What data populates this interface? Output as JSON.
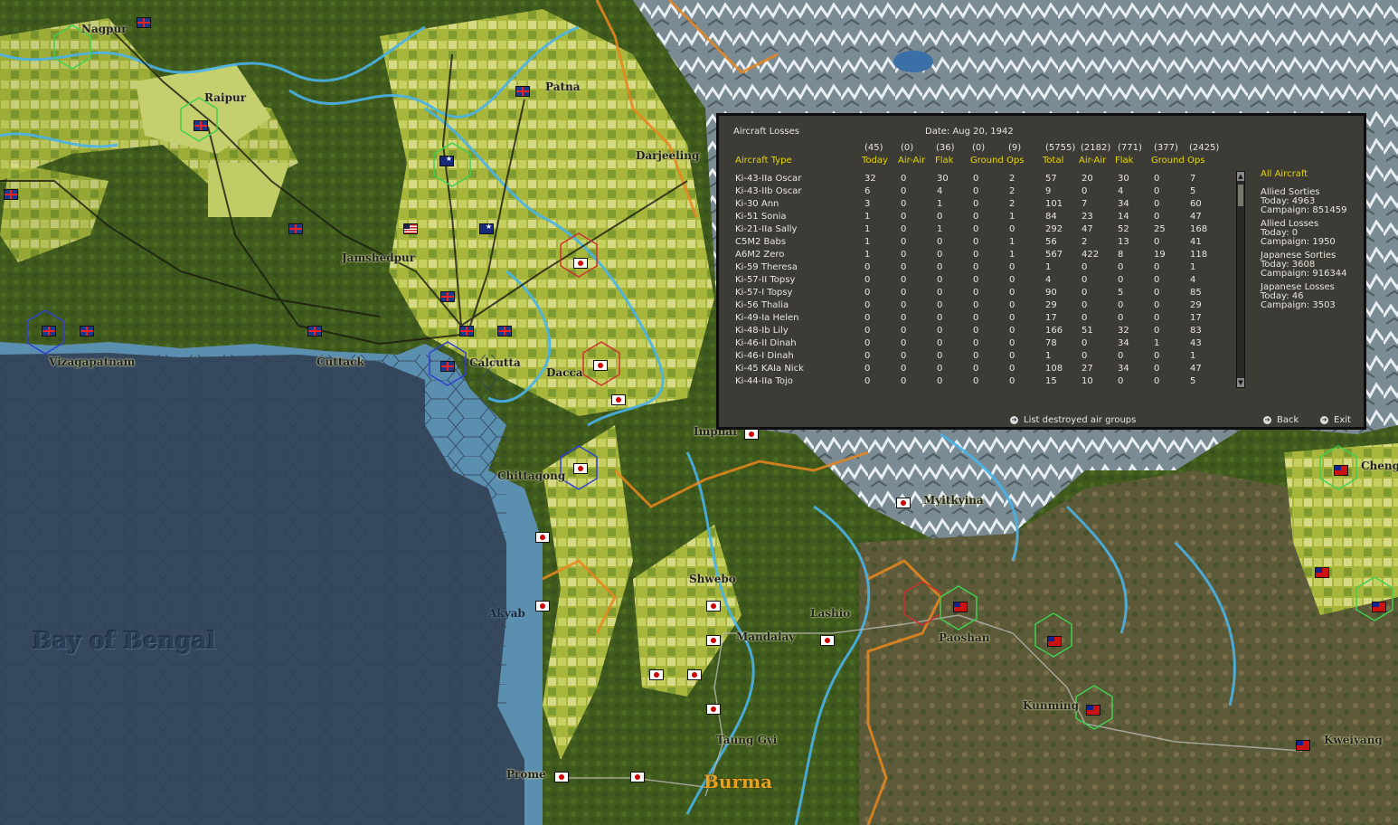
{
  "map": {
    "sea_label": "Bay of Bengal",
    "region_label": "Burma",
    "cities": [
      "Nagpur",
      "Raipur",
      "Patna",
      "Darjeeling",
      "Jamshedpur",
      "Vizagapatnam",
      "Cuttack",
      "Calcutta",
      "Dacca",
      "Imphal",
      "Chittagong",
      "Myitkyina",
      "Shwebo",
      "Akyab",
      "Lashio",
      "Mandalay",
      "Paoshan",
      "Kunming",
      "Taung Gyi",
      "Prome",
      "Kweiyang",
      "Cheng"
    ]
  },
  "losses": {
    "title": "Aircraft Losses",
    "date": "Date: Aug 20, 1942",
    "type_header": "Aircraft Type",
    "allied_totals": [
      "(45)",
      "(0)",
      "(36)",
      "(0)",
      "(9)"
    ],
    "campaign_totals": [
      "(5755)",
      "(2182)",
      "(771)",
      "(377)",
      "(2425)"
    ],
    "headers_today": [
      "Today",
      "Air-Air",
      "Flak",
      "Ground",
      "Ops"
    ],
    "headers_total": [
      "Total",
      "Air-Air",
      "Flak",
      "Ground",
      "Ops"
    ],
    "rows": [
      [
        "Ki-43-IIa Oscar",
        "32",
        "0",
        "30",
        "0",
        "2",
        "57",
        "20",
        "30",
        "0",
        "7"
      ],
      [
        "Ki-43-IIb Oscar",
        "6",
        "0",
        "4",
        "0",
        "2",
        "9",
        "0",
        "4",
        "0",
        "5"
      ],
      [
        "Ki-30 Ann",
        "3",
        "0",
        "1",
        "0",
        "2",
        "101",
        "7",
        "34",
        "0",
        "60"
      ],
      [
        "Ki-51 Sonia",
        "1",
        "0",
        "0",
        "0",
        "1",
        "84",
        "23",
        "14",
        "0",
        "47"
      ],
      [
        "Ki-21-IIa Sally",
        "1",
        "0",
        "1",
        "0",
        "0",
        "292",
        "47",
        "52",
        "25",
        "168"
      ],
      [
        "C5M2 Babs",
        "1",
        "0",
        "0",
        "0",
        "1",
        "56",
        "2",
        "13",
        "0",
        "41"
      ],
      [
        "A6M2 Zero",
        "1",
        "0",
        "0",
        "0",
        "1",
        "567",
        "422",
        "8",
        "19",
        "118"
      ],
      [
        "Ki-59 Theresa",
        "0",
        "0",
        "0",
        "0",
        "0",
        "1",
        "0",
        "0",
        "0",
        "1"
      ],
      [
        "Ki-57-II Topsy",
        "0",
        "0",
        "0",
        "0",
        "0",
        "4",
        "0",
        "0",
        "0",
        "4"
      ],
      [
        "Ki-57-I Topsy",
        "0",
        "0",
        "0",
        "0",
        "0",
        "90",
        "0",
        "5",
        "0",
        "85"
      ],
      [
        "Ki-56 Thalia",
        "0",
        "0",
        "0",
        "0",
        "0",
        "29",
        "0",
        "0",
        "0",
        "29"
      ],
      [
        "Ki-49-Ia Helen",
        "0",
        "0",
        "0",
        "0",
        "0",
        "17",
        "0",
        "0",
        "0",
        "17"
      ],
      [
        "Ki-48-Ib Lily",
        "0",
        "0",
        "0",
        "0",
        "0",
        "166",
        "51",
        "32",
        "0",
        "83"
      ],
      [
        "Ki-46-II Dinah",
        "0",
        "0",
        "0",
        "0",
        "0",
        "78",
        "0",
        "34",
        "1",
        "43"
      ],
      [
        "Ki-46-I Dinah",
        "0",
        "0",
        "0",
        "0",
        "0",
        "1",
        "0",
        "0",
        "0",
        "1"
      ],
      [
        "Ki-45 KAIa Nick",
        "0",
        "0",
        "0",
        "0",
        "0",
        "108",
        "27",
        "34",
        "0",
        "47"
      ],
      [
        "Ki-44-IIa Tojo",
        "0",
        "0",
        "0",
        "0",
        "0",
        "15",
        "10",
        "0",
        "0",
        "5"
      ]
    ],
    "side": {
      "filter": "All Aircraft",
      "allied_sorties": [
        "Allied Sorties",
        "Today:  4963",
        "Campaign: 851459"
      ],
      "allied_losses": [
        "Allied Losses",
        "Today:  0",
        "Campaign: 1950"
      ],
      "japanese_sorties": [
        "Japanese Sorties",
        "Today:  3608",
        "Campaign: 916344"
      ],
      "japanese_losses": [
        "Japanese Losses",
        "Today:  46",
        "Campaign: 3503"
      ]
    },
    "buttons": {
      "list": "List destroyed air groups",
      "back": "Back",
      "exit": "Exit"
    }
  },
  "colors": {
    "panel_bg": "#3c3b36",
    "header_yellow": "#e6d600",
    "sea_deep": "#35485e",
    "sea_shallow": "#5b8fb0",
    "land_green": "#4f6a1e"
  }
}
